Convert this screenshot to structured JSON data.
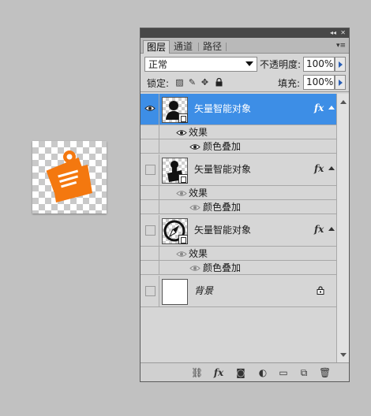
{
  "panel": {
    "tabs": [
      {
        "label": "图层",
        "active": true
      },
      {
        "label": "通道",
        "active": false
      },
      {
        "label": "路径",
        "active": false
      }
    ],
    "blend_mode": "正常",
    "opacity_label": "不透明度:",
    "opacity_value": "100%",
    "lock_label": "锁定:",
    "fill_label": "填充:",
    "fill_value": "100%"
  },
  "layers": [
    {
      "name": "矢量智能对象",
      "selected": true,
      "visible": true,
      "has_fx": true,
      "effects_label": "效果",
      "effect": "颜色叠加",
      "thumb_icon": "user-silhouette-icon"
    },
    {
      "name": "矢量智能对象",
      "selected": false,
      "visible": false,
      "has_fx": true,
      "effects_label": "效果",
      "effect": "颜色叠加",
      "thumb_icon": "pushpin-icon"
    },
    {
      "name": "矢量智能对象",
      "selected": false,
      "visible": false,
      "has_fx": true,
      "effects_label": "效果",
      "effect": "颜色叠加",
      "thumb_icon": "compass-icon"
    },
    {
      "name": "背景",
      "selected": false,
      "visible": false,
      "has_fx": false,
      "locked": true
    }
  ],
  "fx_label": "fx",
  "colors": {
    "accent": "#3d8ee6",
    "icon_orange": "#f4780f",
    "panel_bg": "#d6d6d6"
  },
  "footer_icons": [
    "link-icon",
    "fx-icon",
    "mask-icon",
    "adjustment-icon",
    "folder-icon",
    "new-layer-icon",
    "trash-icon"
  ]
}
